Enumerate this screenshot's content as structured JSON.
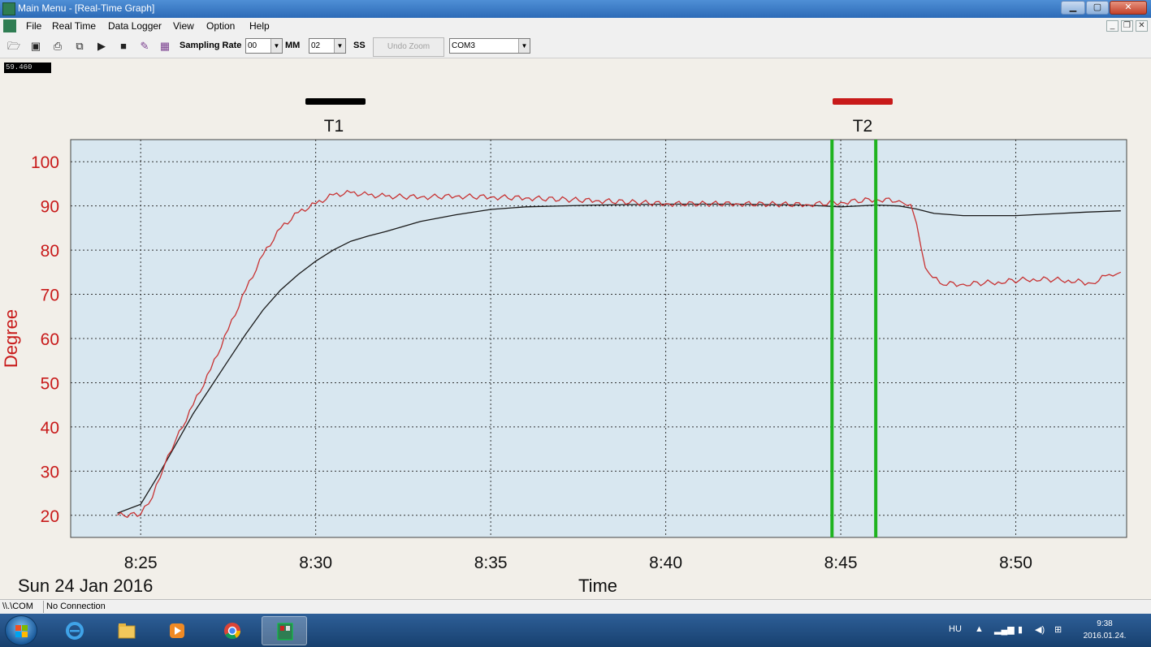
{
  "window": {
    "title": "Main Menu - [Real-Time Graph]",
    "min_label": "▁",
    "max_label": "▢",
    "close_label": "✕"
  },
  "menu": {
    "items": [
      "File",
      "Real Time",
      "Data Logger",
      "View",
      "Option",
      "Help"
    ]
  },
  "toolbar": {
    "icons": [
      "open-folder-icon",
      "save-icon",
      "print-icon",
      "copy-icon",
      "play-icon",
      "stop-icon",
      "chart-edit-icon",
      "chart-view-icon"
    ],
    "sampling_label": "Sampling Rate",
    "mm_value": "00",
    "mm_label": "MM",
    "ss_value": "02",
    "ss_label": "SS",
    "undo_zoom": "Undo Zoom",
    "port_value": "COM3"
  },
  "clock_box": "59.460",
  "chart_data": {
    "type": "line",
    "ylabel": "Degree",
    "xlabel": "Time",
    "date_label": "Sun 24 Jan 2016",
    "ylim": [
      15,
      105
    ],
    "xlim": [
      "8:23:00",
      "8:53:10"
    ],
    "yticks": [
      20,
      30,
      40,
      50,
      60,
      70,
      80,
      90,
      100
    ],
    "xticks": [
      "8:25",
      "8:30",
      "8:35",
      "8:40",
      "8:45",
      "8:50"
    ],
    "grid": true,
    "legend": [
      {
        "name": "T1",
        "color": "#000000"
      },
      {
        "name": "T2",
        "color": "#c81a1a"
      }
    ],
    "markers": [
      {
        "time": "8:44:45",
        "color": "#1fb31f"
      },
      {
        "time": "8:46:00",
        "color": "#1fb31f"
      }
    ],
    "series": [
      {
        "name": "T1",
        "color": "#1a1a1a",
        "x": [
          "8:24:20",
          "8:25:00",
          "8:25:30",
          "8:26:00",
          "8:26:30",
          "8:27:00",
          "8:27:30",
          "8:28:00",
          "8:28:30",
          "8:29:00",
          "8:29:30",
          "8:30:00",
          "8:30:30",
          "8:31:00",
          "8:31:30",
          "8:32:00",
          "8:33:00",
          "8:34:00",
          "8:35:00",
          "8:36:00",
          "8:38:00",
          "8:40:00",
          "8:42:00",
          "8:44:00",
          "8:45:00",
          "8:46:00",
          "8:46:40",
          "8:47:10",
          "8:47:40",
          "8:48:30",
          "8:50:00",
          "8:51:00",
          "8:52:00",
          "8:53:00"
        ],
        "y": [
          20.5,
          22.5,
          29,
          36,
          43,
          49,
          55,
          61,
          66.5,
          71,
          74.5,
          77.5,
          80,
          82,
          83.2,
          84.2,
          86.5,
          88,
          89.2,
          89.8,
          90.2,
          90.4,
          90.4,
          90.2,
          89.8,
          90.2,
          90.0,
          89.3,
          88.3,
          87.8,
          87.8,
          88.2,
          88.6,
          88.9
        ]
      },
      {
        "name": "T2",
        "color": "#c83232",
        "x": [
          "8:24:20",
          "8:25:00",
          "8:25:20",
          "8:25:40",
          "8:26:00",
          "8:26:30",
          "8:27:00",
          "8:27:30",
          "8:28:00",
          "8:28:30",
          "8:29:00",
          "8:29:30",
          "8:30:00",
          "8:30:30",
          "8:31:00",
          "8:31:30",
          "8:32:00",
          "8:33:00",
          "8:34:00",
          "8:35:00",
          "8:36:00",
          "8:38:00",
          "8:40:00",
          "8:42:00",
          "8:44:00",
          "8:45:00",
          "8:46:00",
          "8:46:40",
          "8:47:00",
          "8:47:10",
          "8:47:25",
          "8:47:50",
          "8:48:30",
          "8:49:30",
          "8:50:30",
          "8:51:30",
          "8:52:10",
          "8:52:40",
          "8:53:00"
        ],
        "y": [
          20,
          20.2,
          24,
          31,
          37,
          45,
          53,
          62,
          71,
          79,
          85,
          88.5,
          90.5,
          92.5,
          93,
          92.5,
          92.2,
          92.0,
          92.2,
          92.0,
          91.8,
          91.2,
          90.5,
          90.5,
          90.3,
          90.8,
          91.5,
          91.2,
          90.3,
          86,
          76,
          72.5,
          72.3,
          72.8,
          73.5,
          73.2,
          72.5,
          74.5,
          75
        ]
      }
    ]
  },
  "status": {
    "port": "\\\\.\\COM",
    "connection": "No Connection"
  },
  "taskbar": {
    "apps": [
      "ie-icon",
      "explorer-folder-icon",
      "media-player-icon",
      "chrome-icon",
      "data-logger-app-icon"
    ],
    "language": "HU",
    "time": "9:38",
    "date": "2016.01.24."
  }
}
